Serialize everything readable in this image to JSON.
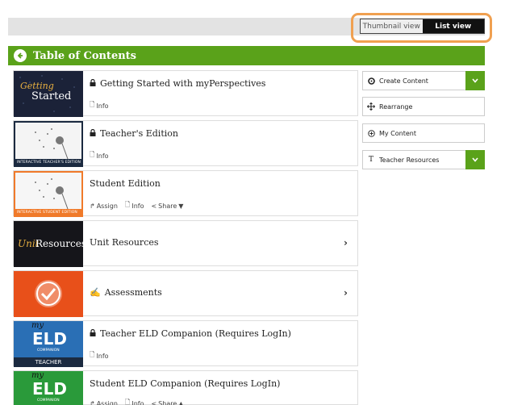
{
  "view_toggle": {
    "thumbnail_label": "Thumbnail view",
    "list_label": "List view"
  },
  "toc": {
    "title": "Table of Contents"
  },
  "thumbs": {
    "getting_started_line1": "Getting",
    "getting_started_line2": "Started",
    "teacher_edition_strip": "INTERACTIVE TEACHER'S EDITION",
    "student_edition_strip": "INTERACTIVE STUDENT EDITION",
    "unit_word1": "Unit",
    "unit_word2": "Resources",
    "eld_my": "my",
    "eld_letters": "ELD",
    "eld_companion": "COMPANION",
    "eld_teacher": "TEACHER"
  },
  "items": [
    {
      "title": "Getting Started with myPerspectives",
      "locked": true,
      "actions": [
        "Info"
      ]
    },
    {
      "title": "Teacher's Edition",
      "locked": true,
      "actions": [
        "Info"
      ]
    },
    {
      "title": "Student Edition",
      "locked": false,
      "actions": [
        "Assign",
        "Info",
        "Share"
      ]
    },
    {
      "title": "Unit Resources",
      "locked": false,
      "actions": []
    },
    {
      "title": "Assessments",
      "locked": false,
      "actions": []
    },
    {
      "title": "Teacher ELD Companion (Requires LogIn)",
      "locked": true,
      "actions": [
        "Info"
      ]
    },
    {
      "title": "Student ELD Companion (Requires LogIn)",
      "locked": false,
      "actions": [
        "Assign",
        "Info",
        "Share"
      ]
    }
  ],
  "labels": {
    "assign": "Assign",
    "info": "Info",
    "share": "Share"
  },
  "sidebar": {
    "create_content": "Create Content",
    "rearrange": "Rearrange",
    "my_content": "My Content",
    "teacher_resources": "Teacher Resources"
  },
  "colors": {
    "accent_green": "#5aa21a",
    "highlight_orange": "#f0a050",
    "eld_teacher_blue": "#2a6fb5",
    "eld_student_green": "#2a9a3a",
    "student_orange": "#f07a2a"
  }
}
